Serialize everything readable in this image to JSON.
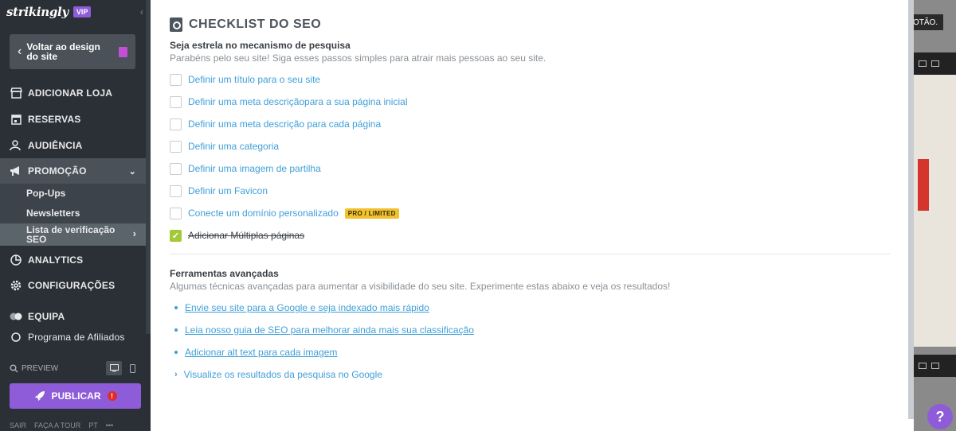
{
  "sidebar": {
    "logo": "strikingly",
    "vip_badge": "VIP",
    "back_button": "Voltar ao design do site",
    "nav": [
      {
        "label": "ADICIONAR LOJA",
        "icon": "store-icon"
      },
      {
        "label": "RESERVAS",
        "icon": "calendar-icon"
      },
      {
        "label": "AUDIÊNCIA",
        "icon": "audience-icon"
      },
      {
        "label": "PROMOÇÃO",
        "icon": "megaphone-icon"
      },
      {
        "label": "ANALYTICS",
        "icon": "analytics-icon"
      },
      {
        "label": "CONFIGURAÇÕES",
        "icon": "gear-icon"
      },
      {
        "label": "EQUIPA",
        "icon": "team-icon"
      },
      {
        "label": "Programa de Afiliados",
        "icon": "affiliate-icon"
      }
    ],
    "sub_items": [
      "Pop-Ups",
      "Newsletters",
      "Lista de verificação SEO"
    ],
    "preview_label": "PREVIEW",
    "publish_label": "PUBLICAR",
    "publish_alert": "!",
    "footer": [
      "SAIR",
      "FAÇA A TOUR",
      "PT",
      "•••"
    ]
  },
  "panel": {
    "title": "CHECKLIST DO SEO",
    "checklist_heading": "Seja estrela no mecanismo de pesquisa",
    "checklist_desc": "Parabéns pelo seu site! Siga esses passos simples para atrair mais pessoas ao seu site.",
    "checklist": [
      {
        "label": "Definir um título para o seu site",
        "checked": false
      },
      {
        "label": "Definir uma meta descriçãopara a sua página inicial",
        "checked": false
      },
      {
        "label": "Definir uma meta descrição para cada página",
        "checked": false
      },
      {
        "label": "Definir uma categoria",
        "checked": false
      },
      {
        "label": "Definir uma imagem de partilha",
        "checked": false
      },
      {
        "label": "Definir um Favicon",
        "checked": false
      },
      {
        "label": "Conecte um domínio personalizado",
        "checked": false,
        "badge": "PRO / LIMITED"
      },
      {
        "label": "Adicionar Múltiplas páginas",
        "checked": true
      }
    ],
    "tools_heading": "Ferramentas avançadas",
    "tools_desc": "Algumas técnicas avançadas para aumentar a visibilidade do seu site. Experimente estas abaixo e veja os resultados!",
    "tools": [
      "Envie seu site para a Google e seja indexado mais rápido",
      "Leia nosso guia de SEO para melhorar ainda mais sua classificação",
      "Adicionar alt text para cada imagem",
      "Visualize os resultados da pesquisa no Google"
    ]
  },
  "background": {
    "button_fragment": "OTÃO."
  },
  "help_label": "?",
  "colors": {
    "accent": "#8e5cd9",
    "link": "#3f9fd8",
    "checked": "#a3c93a",
    "badge": "#f2c12e",
    "sidebar": "#2b3036"
  }
}
